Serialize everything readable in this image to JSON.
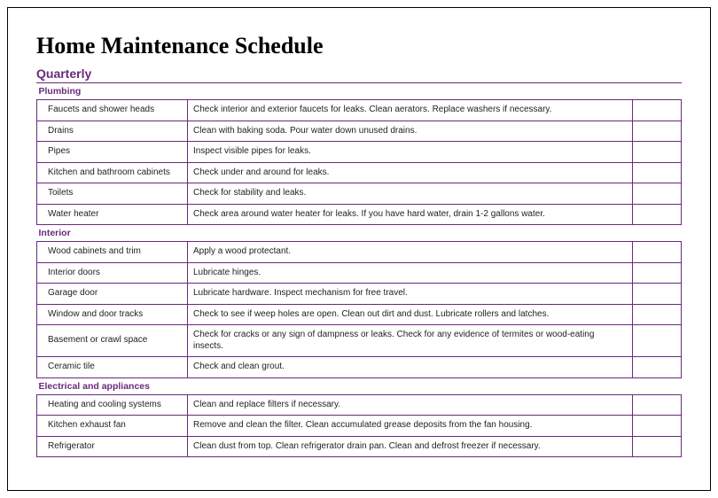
{
  "title": "Home Maintenance Schedule",
  "scheduleType": "Quarterly",
  "categories": [
    {
      "name": "Plumbing",
      "items": [
        {
          "item": "Faucets and shower heads",
          "desc": "Check interior and exterior faucets for leaks. Clean aerators. Replace washers if necessary."
        },
        {
          "item": "Drains",
          "desc": "Clean with baking soda. Pour water down unused drains."
        },
        {
          "item": "Pipes",
          "desc": "Inspect visible pipes for leaks."
        },
        {
          "item": "Kitchen and bathroom cabinets",
          "desc": "Check under and around for leaks."
        },
        {
          "item": "Toilets",
          "desc": "Check for stability and leaks."
        },
        {
          "item": "Water heater",
          "desc": "Check area around water heater for leaks. If you have hard water, drain 1-2 gallons water."
        }
      ]
    },
    {
      "name": "Interior",
      "items": [
        {
          "item": "Wood cabinets and trim",
          "desc": "Apply a wood protectant."
        },
        {
          "item": "Interior doors",
          "desc": "Lubricate hinges."
        },
        {
          "item": "Garage door",
          "desc": "Lubricate hardware. Inspect mechanism for free travel."
        },
        {
          "item": "Window and door tracks",
          "desc": "Check to see if weep holes are open. Clean out dirt and dust. Lubricate rollers and latches."
        },
        {
          "item": "Basement or crawl space",
          "desc": "Check for cracks or any sign of dampness or leaks. Check for any evidence of termites or wood-eating insects."
        },
        {
          "item": "Ceramic tile",
          "desc": "Check and clean grout."
        }
      ]
    },
    {
      "name": "Electrical and appliances",
      "items": [
        {
          "item": "Heating and cooling systems",
          "desc": "Clean and replace filters if necessary."
        },
        {
          "item": "Kitchen exhaust fan",
          "desc": "Remove and clean the filter. Clean accumulated grease deposits from the fan housing."
        },
        {
          "item": "Refrigerator",
          "desc": "Clean dust from top. Clean refrigerator drain pan. Clean and defrost freezer if necessary."
        }
      ]
    }
  ]
}
